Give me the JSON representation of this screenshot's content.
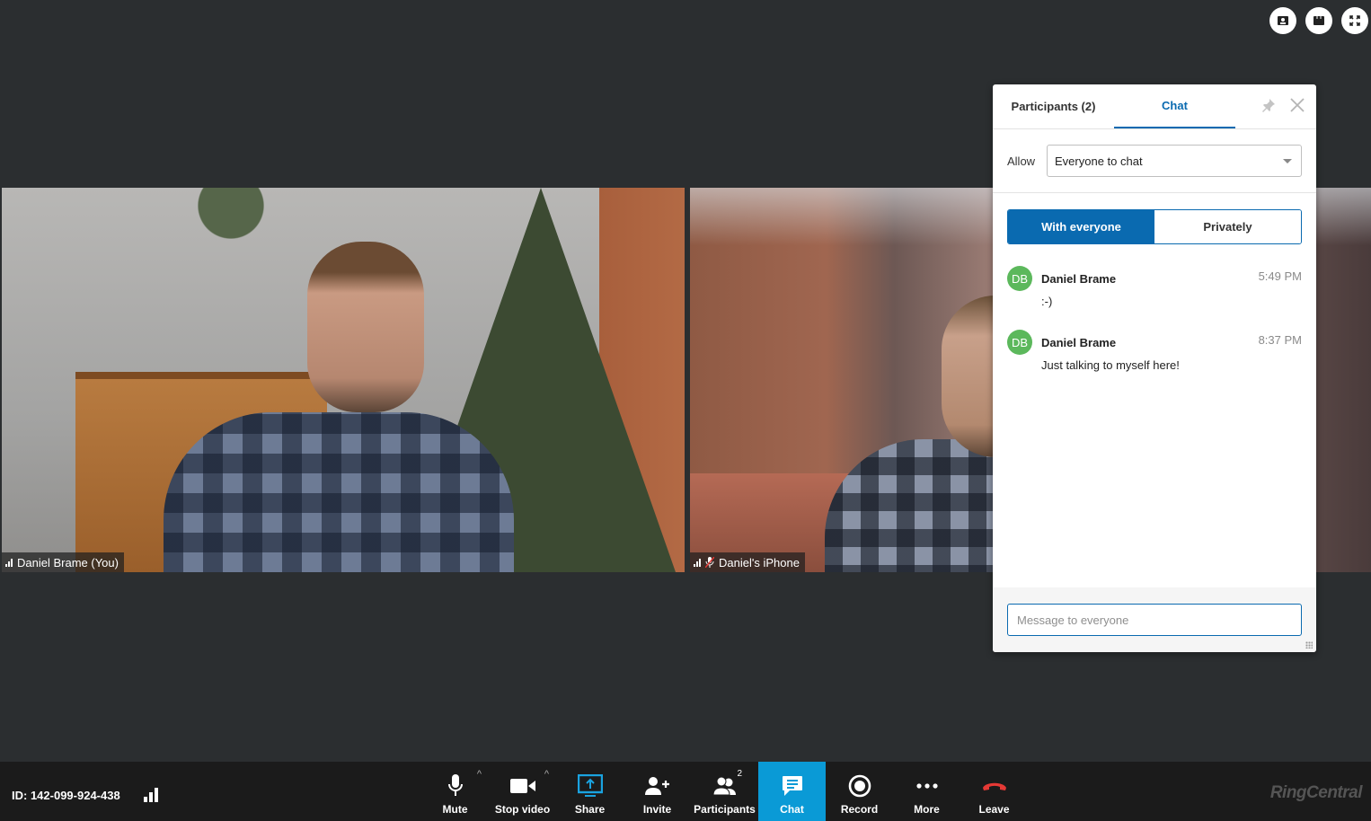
{
  "top_controls": [
    {
      "name": "speaker-view-button",
      "icon": "speaker-view-icon"
    },
    {
      "name": "gallery-view-button",
      "icon": "gallery-view-icon"
    },
    {
      "name": "fullscreen-button",
      "icon": "fullscreen-icon"
    }
  ],
  "videos": [
    {
      "name": "Daniel Brame (You)",
      "signal_icon": "signal-bars-icon",
      "muted": false
    },
    {
      "name": "Daniel's iPhone",
      "signal_icon": "signal-bars-icon",
      "muted": true
    }
  ],
  "panel": {
    "tabs": [
      {
        "label": "Participants (2)",
        "active": false
      },
      {
        "label": "Chat",
        "active": true
      }
    ],
    "pin_icon": "pin-icon",
    "close_icon": "close-icon",
    "allow_label": "Allow",
    "allow_value": "Everyone to chat",
    "segment": {
      "with_everyone": "With everyone",
      "privately": "Privately",
      "selected": "With everyone"
    },
    "messages": [
      {
        "initials": "DB",
        "sender": "Daniel Brame",
        "time": "5:49 PM",
        "text": ":-)"
      },
      {
        "initials": "DB",
        "sender": "Daniel Brame",
        "time": "8:37 PM",
        "text": "Just talking to myself here!"
      }
    ],
    "composer_placeholder": "Message to everyone",
    "avatar_color": "#5cb85c",
    "accent_color": "#0a6ab0"
  },
  "bottom_bar": {
    "meeting_id": "ID: 142-099-924-438",
    "tools": [
      {
        "label": "Mute",
        "icon": "microphone-icon",
        "has_menu": true
      },
      {
        "label": "Stop video",
        "icon": "video-camera-icon",
        "has_menu": true
      },
      {
        "label": "Share",
        "icon": "share-screen-icon"
      },
      {
        "label": "Invite",
        "icon": "add-person-icon"
      },
      {
        "label": "Participants",
        "icon": "participants-icon",
        "badge": "2"
      },
      {
        "label": "Chat",
        "icon": "chat-icon",
        "active": true
      },
      {
        "label": "Record",
        "icon": "record-icon"
      },
      {
        "label": "More",
        "icon": "more-icon"
      },
      {
        "label": "Leave",
        "icon": "hang-up-icon"
      }
    ],
    "menu_caret": "^",
    "brand": "RingCentral",
    "active_color": "#0a9ad6",
    "share_color": "#1aa3e0",
    "leave_color": "#e53935"
  }
}
